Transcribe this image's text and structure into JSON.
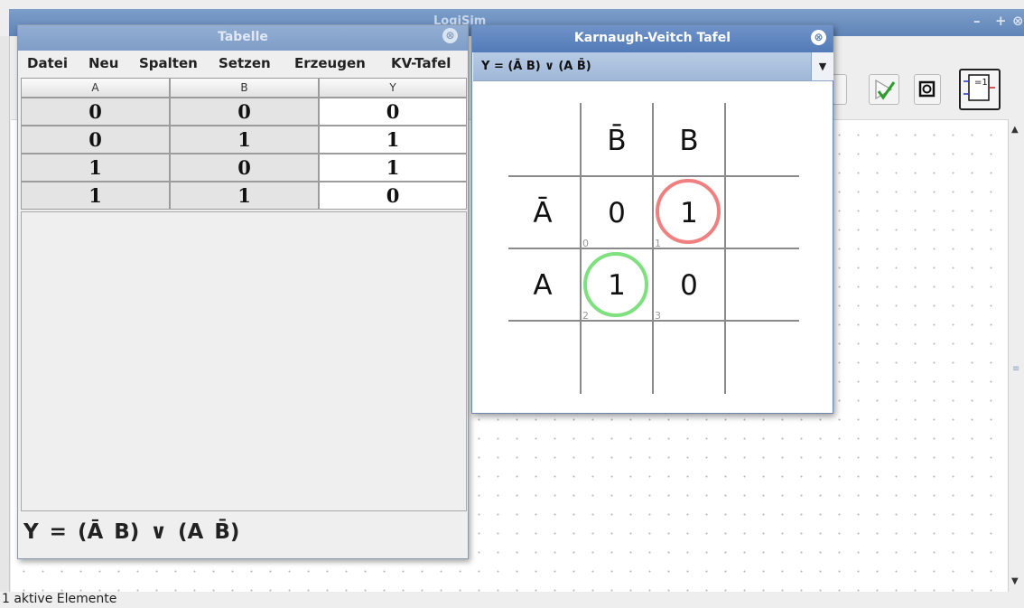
{
  "app": {
    "title": "LogiSim",
    "window_controls": {
      "min": "–",
      "max": "+",
      "close": "⊗"
    },
    "status_text": "1 aktive Elemente",
    "toolbar": {
      "buttons": [
        {
          "icon": "play-check-icon"
        },
        {
          "icon": "record-icon"
        },
        {
          "icon": "xor-gate-icon",
          "label": "=1"
        }
      ]
    }
  },
  "table_window": {
    "title": "Tabelle",
    "close_glyph": "⊗",
    "menu": [
      "Datei",
      "Neu",
      "Spalten",
      "Setzen",
      "Erzeugen",
      "KV-Tafel"
    ],
    "columns": [
      "A",
      "B",
      "Y"
    ],
    "rows": [
      [
        "0",
        "0",
        "0"
      ],
      [
        "0",
        "1",
        "1"
      ],
      [
        "1",
        "0",
        "1"
      ],
      [
        "1",
        "1",
        "0"
      ]
    ],
    "formula": "Y = (Ā B) ∨ (A B̄)"
  },
  "kv_window": {
    "title": "Karnaugh-Veitch Tafel",
    "close_glyph": "⊗",
    "selected_expression": "Y = (Ā B) ∨ (A B̄)",
    "dropdown_glyph": "▼",
    "col_labels": [
      "B̄",
      "B"
    ],
    "row_labels": [
      "Ā",
      "A"
    ],
    "cells": [
      {
        "value": "0",
        "index": "0",
        "circled": false
      },
      {
        "value": "1",
        "index": "1",
        "circled": true,
        "circle_color": "#f08080"
      },
      {
        "value": "1",
        "index": "2",
        "circled": true,
        "circle_color": "#7ee07e"
      },
      {
        "value": "0",
        "index": "3",
        "circled": false
      }
    ]
  }
}
